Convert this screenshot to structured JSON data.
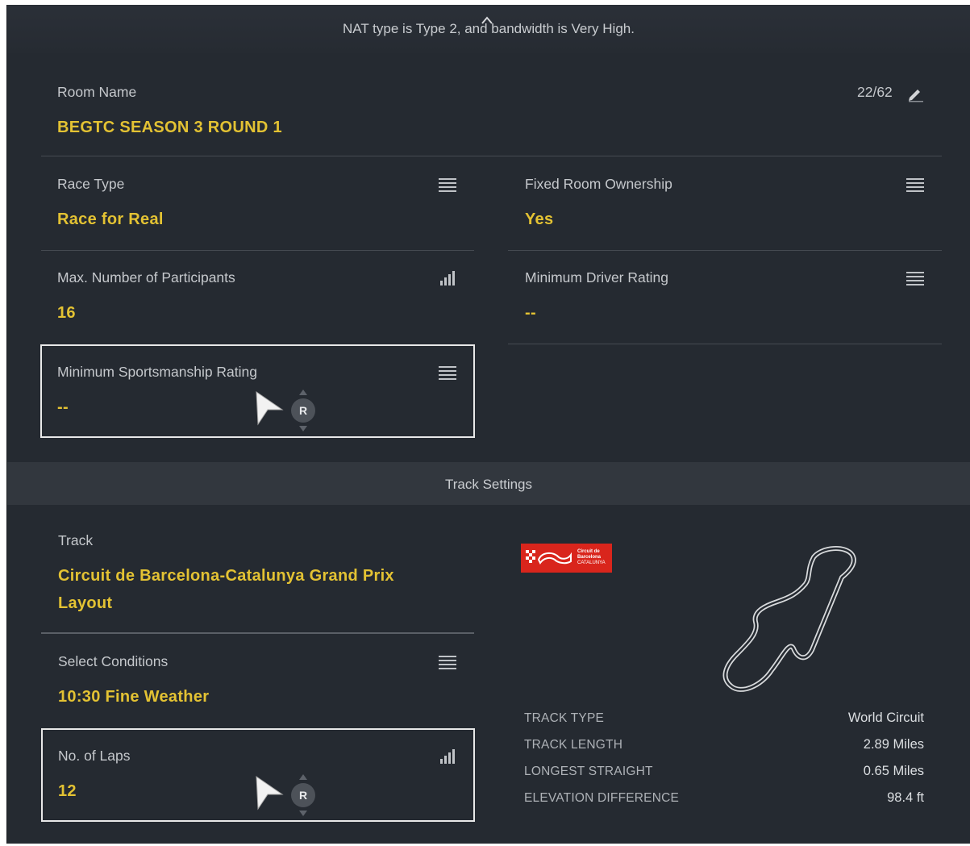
{
  "header": {
    "nat_text": "NAT type is Type 2, and bandwidth is Very High."
  },
  "room_name": {
    "label": "Room Name",
    "value": "BEGTC SEASON 3 ROUND 1",
    "char_count": "22/62"
  },
  "race_type": {
    "label": "Race Type",
    "value": "Race for Real"
  },
  "fixed_ownership": {
    "label": "Fixed Room Ownership",
    "value": "Yes"
  },
  "max_participants": {
    "label": "Max. Number of Participants",
    "value": "16"
  },
  "min_driver_rating": {
    "label": "Minimum Driver Rating",
    "value": "--"
  },
  "min_sportsmanship": {
    "label": "Minimum Sportsmanship Rating",
    "value": "--"
  },
  "track_section": {
    "title": "Track Settings"
  },
  "track": {
    "label": "Track",
    "value_line1": "Circuit de Barcelona-Catalunya Grand Prix",
    "value_line2": "Layout"
  },
  "conditions": {
    "label": "Select Conditions",
    "value": "10:30 Fine Weather"
  },
  "laps": {
    "label": "No. of Laps",
    "value": "12"
  },
  "logo": {
    "text_line1": "Circuit de",
    "text_line2": "Barcelona",
    "text_line3": "CATALUNYA"
  },
  "button_hint": {
    "label": "R"
  },
  "track_stats": [
    {
      "label": "TRACK TYPE",
      "value": "World Circuit"
    },
    {
      "label": "TRACK LENGTH",
      "value": "2.89 Miles"
    },
    {
      "label": "LONGEST STRAIGHT",
      "value": "0.65 Miles"
    },
    {
      "label": "ELEVATION DIFFERENCE",
      "value": "98.4 ft"
    }
  ],
  "colors": {
    "accent": "#e3c233",
    "background": "#252a31",
    "logo_red": "#d9251c"
  },
  "icons": [
    "chevron-up-icon",
    "pencil-icon",
    "menu-list-icon",
    "signal-bars-icon",
    "pointer-cursor-icon",
    "r-button-icon",
    "track-map-icon"
  ]
}
